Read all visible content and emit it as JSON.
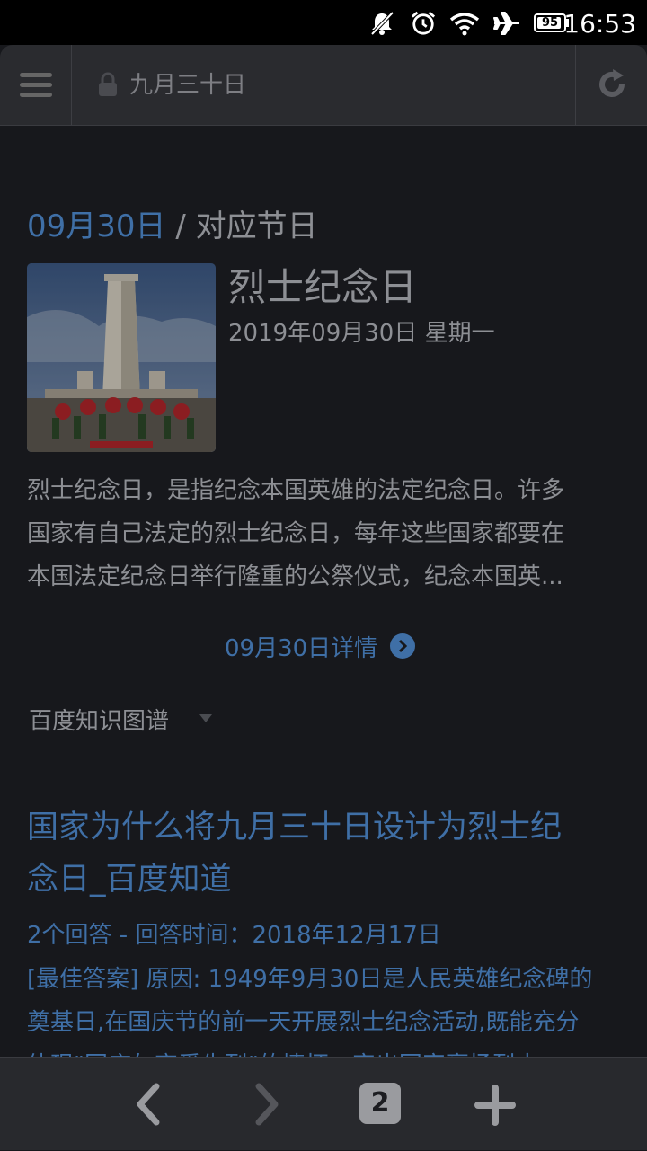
{
  "status_bar": {
    "time": "16:53",
    "battery": "95",
    "battery_level": 0.95,
    "icons": [
      "notifications-muted-icon",
      "alarm-icon",
      "wifi-icon",
      "airplane-mode-icon",
      "battery-icon"
    ]
  },
  "url_bar": {
    "text": "九月三十日",
    "icons": [
      "menu-icon",
      "lock-icon",
      "reload-icon"
    ]
  },
  "festival_card": {
    "date": "09月30日",
    "separator": "/",
    "label": "对应节日",
    "title": "烈士纪念日",
    "full_date": "2019年09月30日 星期一",
    "description_lines": [
      "烈士纪念日，是指纪念本国英雄的法定纪念日。许多",
      "国家有自己法定的烈士纪念日，每年这些国家都要在",
      "本国法定纪念日举行隆重的公祭仪式，纪念本国英..."
    ],
    "detail_link": "09月30日详情",
    "source": "百度知识图谱"
  },
  "result": {
    "title_lines": [
      "国家为什么将九月三十日设计为烈士纪",
      "念日_百度知道"
    ],
    "meta": "2个回答 - 回答时间：2018年12月17日",
    "snippet_lines": [
      "[最佳答案] 原因: 1949年9月30日是人民英雄纪念碑的",
      "奠基日,在国庆节的前一天开展烈士纪念活动,既能充分",
      "体现\"国庆勿忘爱先烈\"的情怀，突出国家褒扬烈士"
    ]
  },
  "bottom_bar": {
    "tab_count": "2",
    "icons": [
      "back-icon",
      "forward-icon",
      "tabs-icon",
      "new-tab-icon"
    ]
  },
  "colors": {
    "background": "#17181c",
    "link": "#3f6fa6",
    "text": "#8d8f94",
    "toolbar": "#2a2b2f"
  }
}
